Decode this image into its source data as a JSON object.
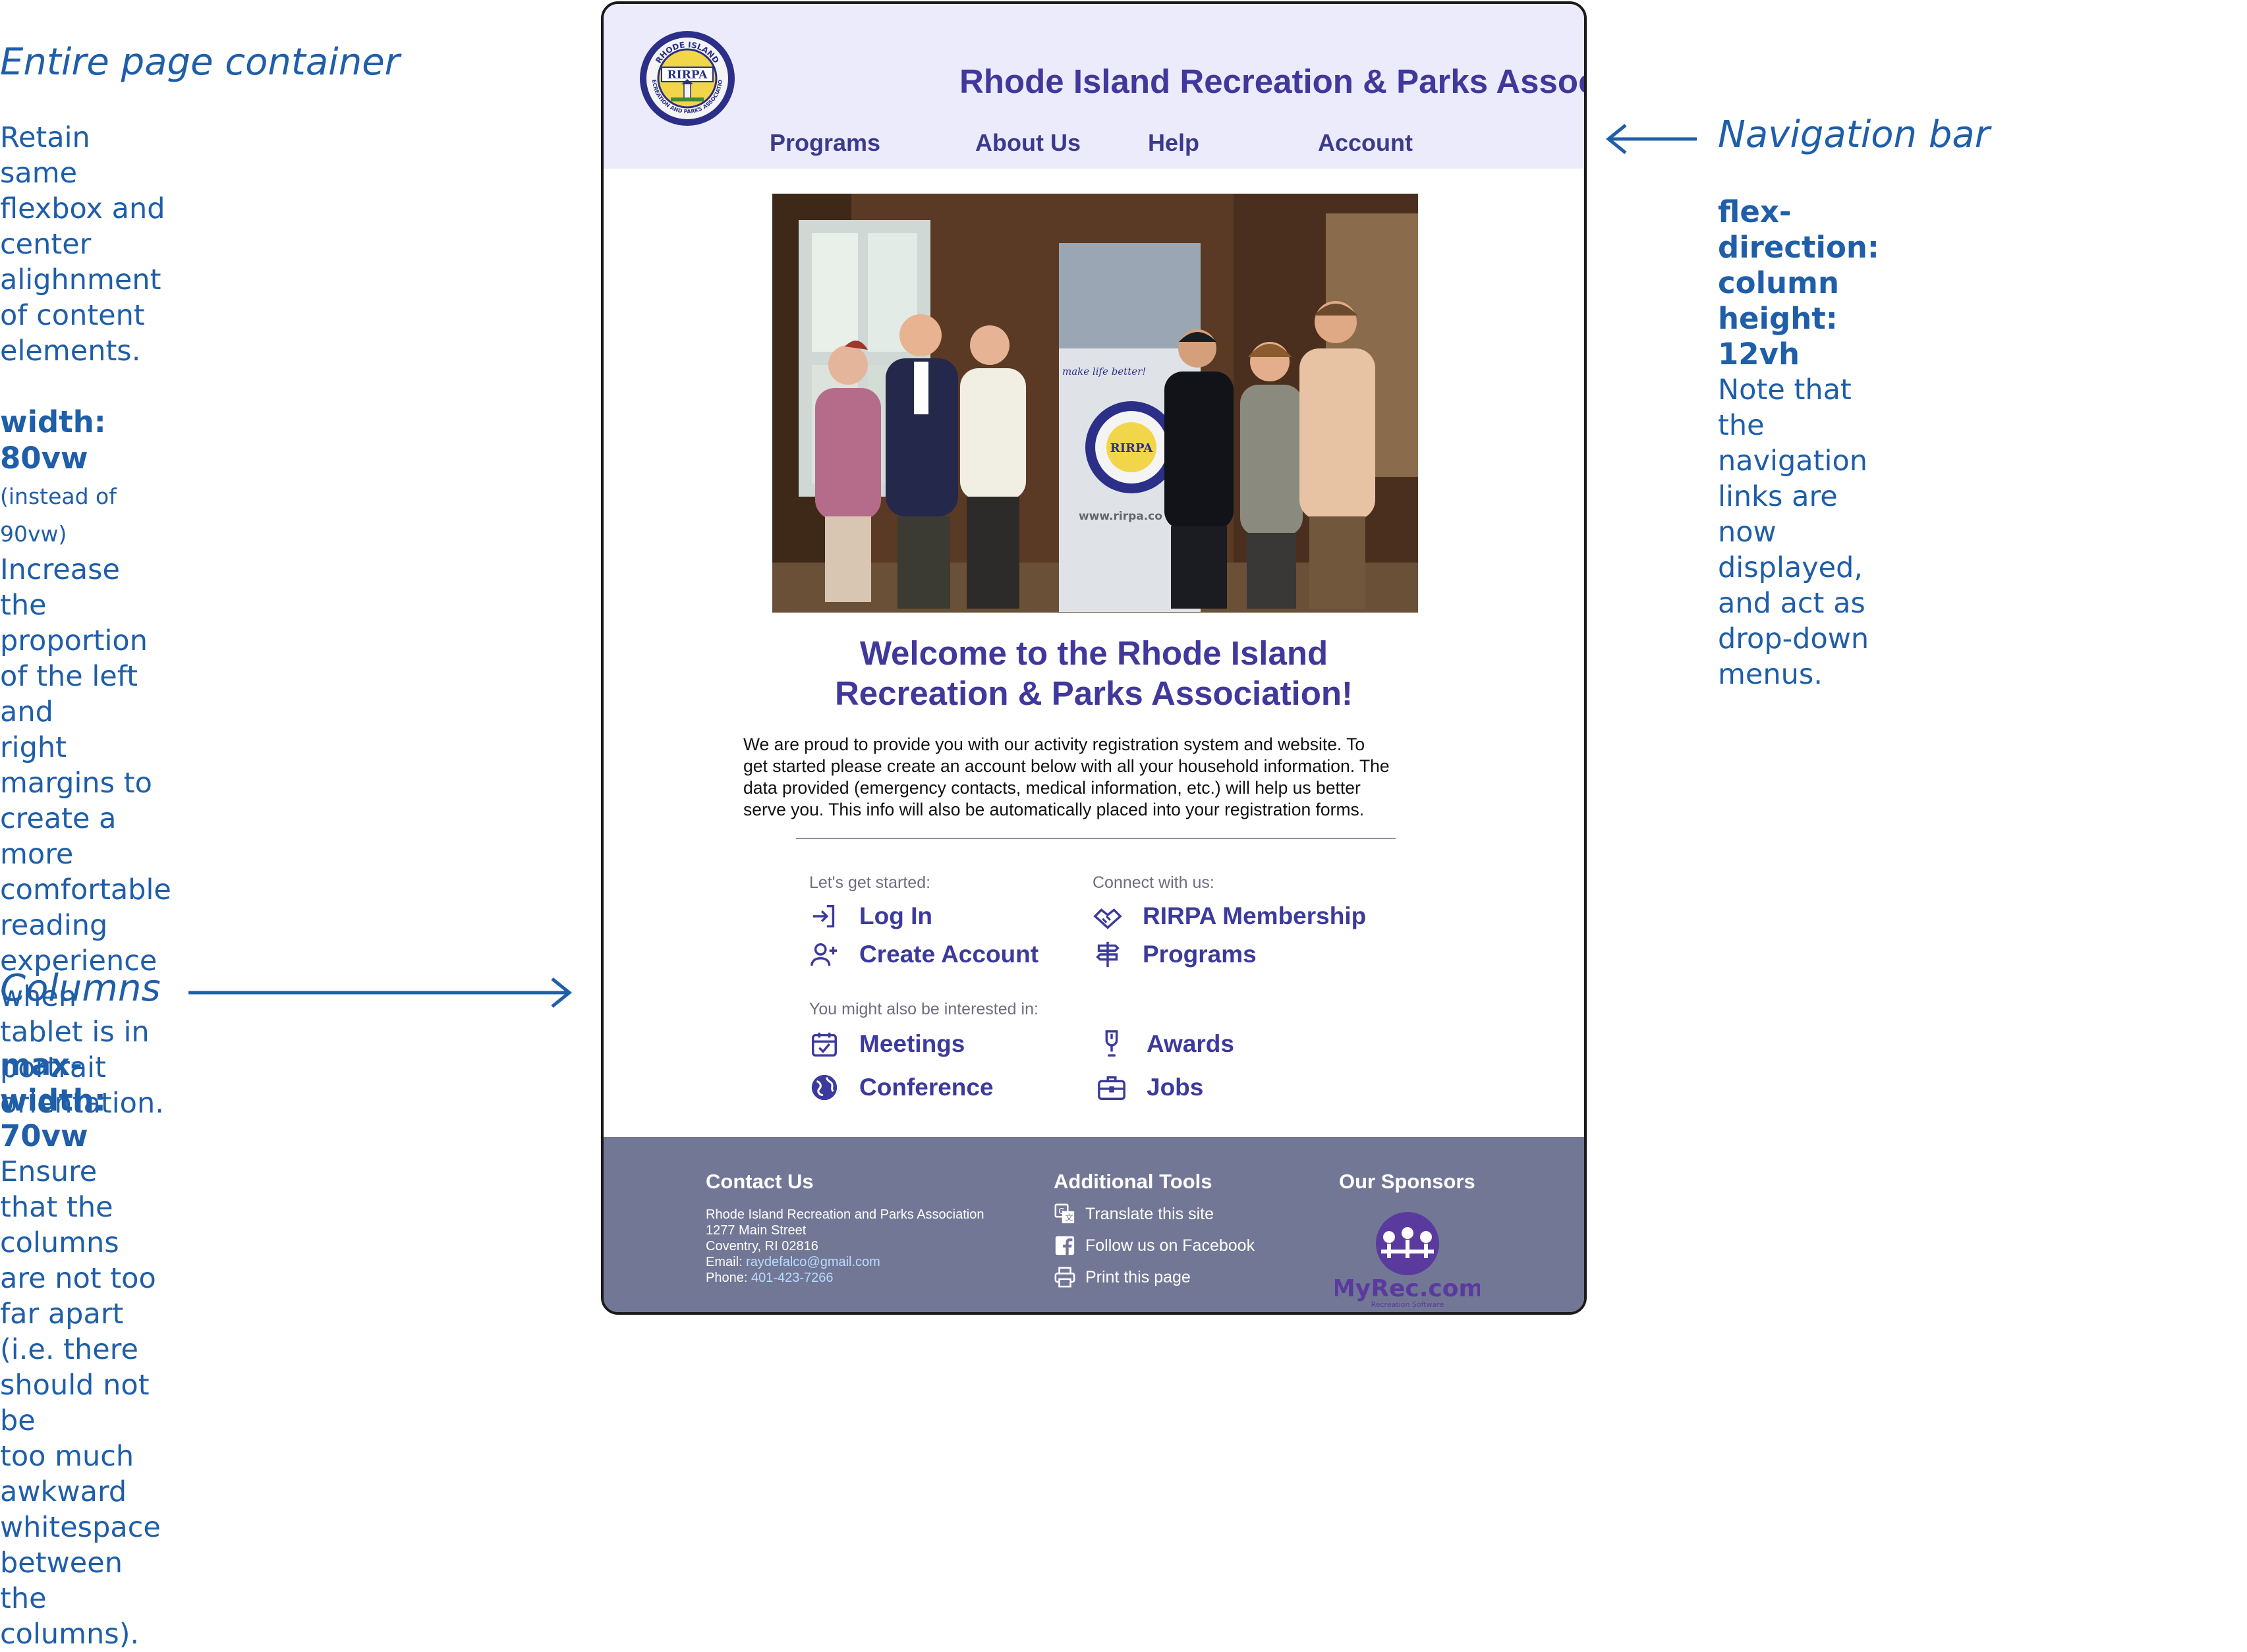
{
  "annotations": {
    "page_container": {
      "title": "Entire page container",
      "line1": "Retain same flexbox and center",
      "line2": "alighnment of content elements.",
      "width_rule": "width: 80vw",
      "width_note": "(instead of 90vw)",
      "line3": "Increase the proportion of the left and",
      "line4": "right margins to create a more",
      "line5": "comfortable reading experience when",
      "line6": "tablet is in portrait orientation."
    },
    "nav_bar": {
      "title": "Navigation bar",
      "rule1": "flex-direction: column",
      "rule2": "height: 12vh",
      "line1": "Note that the navigation links are now",
      "line2": "displayed, and act as drop-down",
      "line3": "menus."
    },
    "columns": {
      "title": "Columns",
      "rule": "max-width: 70vw",
      "line1": "Ensure that the columns are not too",
      "line2": "far apart (i.e. there should not be",
      "line3": "too much awkward whitespace",
      "line4": "between the columns)."
    }
  },
  "site": {
    "title": "Rhode Island Recreation & Parks Association",
    "logo": {
      "top_text": "RHODE ISLAND",
      "center_text": "RIRPA",
      "bottom_text": "RECREATION AND PARKS ASSOCIATION"
    },
    "nav": [
      "Programs",
      "About Us",
      "Help",
      "Account"
    ],
    "hero": {
      "banner_text": "make life better!",
      "banner_url": "www.rirpa.co",
      "banner_logo": "RIRPA"
    },
    "welcome_line1": "Welcome to the Rhode Island",
    "welcome_line2": "Recreation & Parks Association!",
    "intro": [
      "We are proud to provide you with our activity registration system and website. To",
      "get started please create an account below with all your household information. The",
      "data provided (emergency contacts, medical information, etc.) will help us better",
      "serve you. This info will also be automatically placed into your registration forms."
    ],
    "get_started": {
      "label": "Let's get started:",
      "items": [
        {
          "label": "Log In",
          "icon": "login-icon"
        },
        {
          "label": "Create Account",
          "icon": "add-user-icon"
        }
      ]
    },
    "connect": {
      "label": "Connect with us:",
      "items": [
        {
          "label": "RIRPA Membership",
          "icon": "handshake-icon"
        },
        {
          "label": "Programs",
          "icon": "signpost-icon"
        }
      ]
    },
    "interested": {
      "label": "You might also be interested in:",
      "items": [
        {
          "label": "Meetings",
          "icon": "calendar-check-icon"
        },
        {
          "label": "Awards",
          "icon": "award-icon"
        },
        {
          "label": "Conference",
          "icon": "globe-icon"
        },
        {
          "label": "Jobs",
          "icon": "briefcase-icon"
        }
      ]
    },
    "footer": {
      "contact_heading": "Contact Us",
      "org": "Rhode Island Recreation and Parks Association",
      "street": "1277 Main Street",
      "city": "Coventry, RI 02816",
      "email_label": "Email: ",
      "email": "raydefalco@gmail.com",
      "phone_label": "Phone: ",
      "phone": "401-423-7266",
      "tools_heading": "Additional Tools",
      "tools": [
        "Translate this site",
        "Follow us on Facebook",
        "Print this page"
      ],
      "sponsors_heading": "Our Sponsors",
      "sponsor_name": "MyRec.com",
      "sponsor_tagline": "Recreation Software"
    }
  },
  "colors": {
    "annotation": "#1f5ea8",
    "brand": "#41389c",
    "nav_bg": "#ecebfc",
    "footer_bg": "#737796",
    "sponsor": "#5b3a9e"
  }
}
